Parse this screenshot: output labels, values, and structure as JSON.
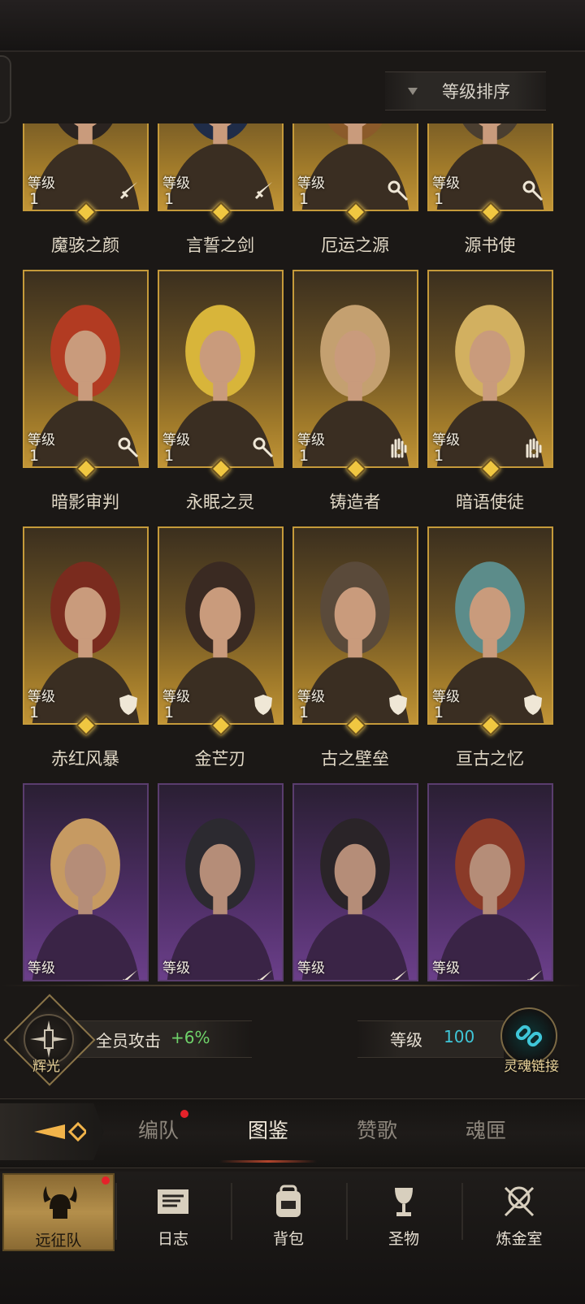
{
  "sort": {
    "label": "等级排序"
  },
  "level_label": "等级",
  "heroes": [
    {
      "name": "魔骇之颜",
      "level": "1",
      "rarity": "gold",
      "class_icon": "sword-icon",
      "gem": true
    },
    {
      "name": "言誓之剑",
      "level": "1",
      "rarity": "gold",
      "class_icon": "sword-icon",
      "gem": true
    },
    {
      "name": "厄运之源",
      "level": "1",
      "rarity": "gold",
      "class_icon": "staff-icon",
      "gem": true
    },
    {
      "name": "源书使",
      "level": "1",
      "rarity": "gold",
      "class_icon": "staff-icon",
      "gem": true
    },
    {
      "name": "暗影审判",
      "level": "1",
      "rarity": "gold",
      "class_icon": "staff-icon",
      "gem": true
    },
    {
      "name": "永眠之灵",
      "level": "1",
      "rarity": "gold",
      "class_icon": "staff-icon",
      "gem": true
    },
    {
      "name": "铸造者",
      "level": "1",
      "rarity": "gold",
      "class_icon": "hand-icon",
      "gem": true
    },
    {
      "name": "暗语使徒",
      "level": "1",
      "rarity": "gold",
      "class_icon": "hand-icon",
      "gem": true
    },
    {
      "name": "赤红风暴",
      "level": "1",
      "rarity": "gold",
      "class_icon": "shield-icon",
      "gem": true
    },
    {
      "name": "金芒刃",
      "level": "1",
      "rarity": "gold",
      "class_icon": "shield-icon",
      "gem": true
    },
    {
      "name": "古之壁垒",
      "level": "1",
      "rarity": "gold",
      "class_icon": "shield-icon",
      "gem": true
    },
    {
      "name": "亘古之忆",
      "level": "1",
      "rarity": "gold",
      "class_icon": "shield-icon",
      "gem": true
    },
    {
      "name": "",
      "level": "",
      "rarity": "purple",
      "class_icon": "sword-icon",
      "gem": false
    },
    {
      "name": "",
      "level": "",
      "rarity": "purple",
      "class_icon": "sword-icon",
      "gem": false
    },
    {
      "name": "",
      "level": "",
      "rarity": "purple",
      "class_icon": "sword-icon",
      "gem": false
    },
    {
      "name": "",
      "level": "",
      "rarity": "purple",
      "class_icon": "sword-icon",
      "gem": false
    }
  ],
  "bonus": {
    "emblem_label": "辉光",
    "text": "全员攻击",
    "value": "+6%"
  },
  "soul_link": {
    "level_label": "等级",
    "level_value": "100",
    "label": "灵魂链接"
  },
  "tabs": [
    {
      "label": "编队",
      "active": false,
      "badge": true
    },
    {
      "label": "图鉴",
      "active": true,
      "badge": false
    },
    {
      "label": "赞歌",
      "active": false,
      "badge": false
    },
    {
      "label": "魂匣",
      "active": false,
      "badge": false
    }
  ],
  "nav": [
    {
      "label": "远征队",
      "icon": "viking-helmet-icon",
      "active": true,
      "badge": true
    },
    {
      "label": "日志",
      "icon": "scroll-icon",
      "active": false,
      "badge": false
    },
    {
      "label": "背包",
      "icon": "backpack-icon",
      "active": false,
      "badge": false
    },
    {
      "label": "圣物",
      "icon": "chalice-icon",
      "active": false,
      "badge": false
    },
    {
      "label": "炼金室",
      "icon": "alchemy-icon",
      "active": false,
      "badge": false
    }
  ],
  "colors": {
    "gold_accent": "#c59a3a",
    "bonus_green": "#6fd36a",
    "link_cyan": "#3fc6d8",
    "badge_red": "#e5222a"
  }
}
